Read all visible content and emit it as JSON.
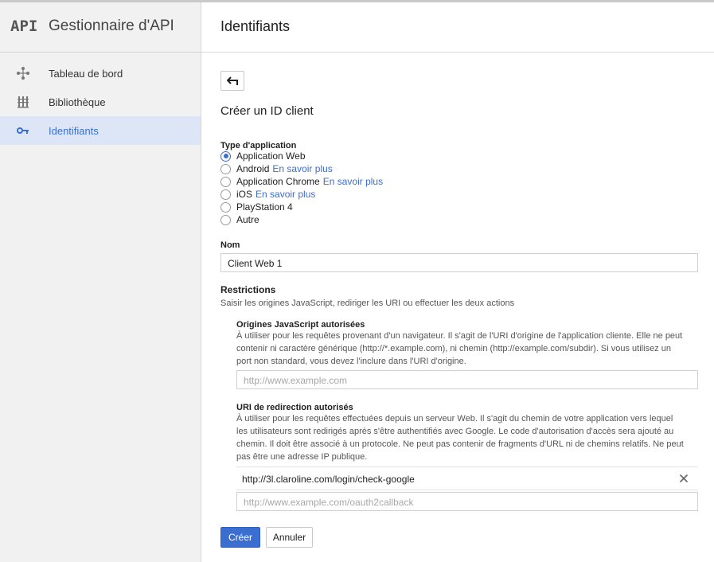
{
  "brand": {
    "logo": "API",
    "title": "Gestionnaire d'API"
  },
  "sidebar": {
    "items": [
      {
        "label": "Tableau de bord",
        "icon": "dashboard-icon"
      },
      {
        "label": "Bibliothèque",
        "icon": "library-icon"
      },
      {
        "label": "Identifiants",
        "icon": "key-icon",
        "active": true
      }
    ]
  },
  "header": {
    "title": "Identifiants"
  },
  "form": {
    "section_title": "Créer un ID client",
    "app_type_label": "Type d'application",
    "app_types": [
      {
        "label": "Application Web",
        "link": "",
        "checked": true
      },
      {
        "label": "Android",
        "link": "En savoir plus",
        "checked": false
      },
      {
        "label": "Application Chrome",
        "link": "En savoir plus",
        "checked": false
      },
      {
        "label": "iOS",
        "link": "En savoir plus",
        "checked": false
      },
      {
        "label": "PlayStation 4",
        "link": "",
        "checked": false
      },
      {
        "label": "Autre",
        "link": "",
        "checked": false
      }
    ],
    "name_label": "Nom",
    "name_value": "Client Web 1",
    "restrictions_title": "Restrictions",
    "restrictions_desc": "Saisir les origines JavaScript, rediriger les URI ou effectuer les deux actions",
    "origins": {
      "title": "Origines JavaScript autorisées",
      "desc_lines": [
        "À utiliser pour les requêtes provenant d'un navigateur. Il s'agit de l'URI d'origine de l'application cliente. Elle ne peut",
        "contenir ni caractère générique (http://*.example.com), ni chemin (http://example.com/subdir). Si vous utilisez un",
        "port non standard, vous devez l'inclure dans l'URI d'origine."
      ],
      "placeholder": "http://www.example.com"
    },
    "redirects": {
      "title": "URI de redirection autorisés",
      "desc_lines": [
        "À utiliser pour les requêtes effectuées depuis un serveur Web. Il s'agit du chemin de votre application vers lequel",
        "les utilisateurs sont redirigés après s'être authentifiés avec Google. Le code d'autorisation d'accès sera ajouté au",
        "chemin. Il doit être associé à un protocole. Ne peut pas contenir de fragments d'URL ni de chemins relatifs. Ne peut",
        "pas être une adresse IP publique."
      ],
      "entry": "http://3l.claroline.com/login/check-google",
      "placeholder": "http://www.example.com/oauth2callback"
    },
    "create_label": "Créer",
    "cancel_label": "Annuler"
  },
  "colors": {
    "accent": "#3b6ed1",
    "sidebar_bg": "#f1f1f1",
    "active_bg": "#dde6f7"
  }
}
